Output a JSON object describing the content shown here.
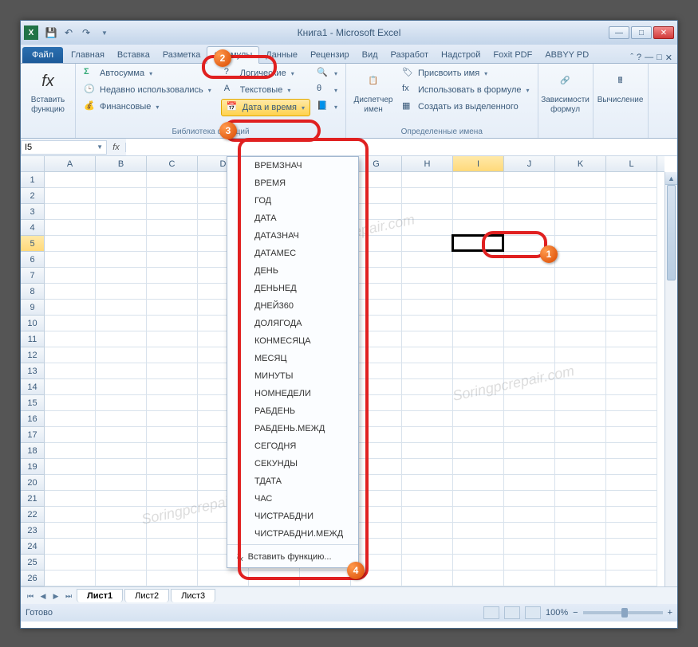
{
  "title": "Книга1 - Microsoft Excel",
  "qat": {
    "save": "💾",
    "undo": "↶",
    "redo": "↷"
  },
  "win": {
    "min": "—",
    "max": "□",
    "close": "✕"
  },
  "tabs": {
    "file": "Файл",
    "items": [
      "Главная",
      "Вставка",
      "Разметка",
      "Формулы",
      "Данные",
      "Рецензир",
      "Вид",
      "Разработ",
      "Надстрой",
      "Foxit PDF",
      "ABBYY PD"
    ],
    "active_index": 3
  },
  "ribbon": {
    "insert_fn": {
      "label": "Вставить\nфункцию"
    },
    "library": {
      "autosum": "Автосумма",
      "recent": "Недавно использовались",
      "financial": "Финансовые",
      "logical": "Логические",
      "text": "Текстовые",
      "datetime": "Дата и время",
      "lookup": "",
      "more": "",
      "group_label": "Библиотека функций"
    },
    "names": {
      "manager": "Диспетчер\nимен",
      "assign": "Присвоить имя",
      "use": "Использовать в формуле",
      "create": "Создать из выделенного",
      "group_label": "Определенные имена"
    },
    "deps": {
      "label": "Зависимости\nформул"
    },
    "calc": {
      "label": "Вычисление"
    }
  },
  "name_box": "I5",
  "columns": [
    "A",
    "B",
    "C",
    "D",
    "E",
    "F",
    "G",
    "H",
    "I",
    "J",
    "K",
    "L"
  ],
  "row_count": 27,
  "selected": {
    "row": 5,
    "col": "I"
  },
  "dropdown": {
    "items": [
      "ВРЕМЗНАЧ",
      "ВРЕМЯ",
      "ГОД",
      "ДАТА",
      "ДАТАЗНАЧ",
      "ДАТАМЕС",
      "ДЕНЬ",
      "ДЕНЬНЕД",
      "ДНЕЙ360",
      "ДОЛЯГОДА",
      "КОНМЕСЯЦА",
      "МЕСЯЦ",
      "МИНУТЫ",
      "НОМНЕДЕЛИ",
      "РАБДЕНЬ",
      "РАБДЕНЬ.МЕЖД",
      "СЕГОДНЯ",
      "СЕКУНДЫ",
      "ТДАТА",
      "ЧАС",
      "ЧИСТРАБДНИ",
      "ЧИСТРАБДНИ.МЕЖД"
    ],
    "footer": "Вставить функцию..."
  },
  "sheets": {
    "items": [
      "Лист1",
      "Лист2",
      "Лист3"
    ],
    "active": 0
  },
  "status": {
    "ready": "Готово",
    "zoom": "100%"
  },
  "callout_badges": [
    "1",
    "2",
    "3",
    "4"
  ],
  "watermark": "Soringpcrepair.com"
}
